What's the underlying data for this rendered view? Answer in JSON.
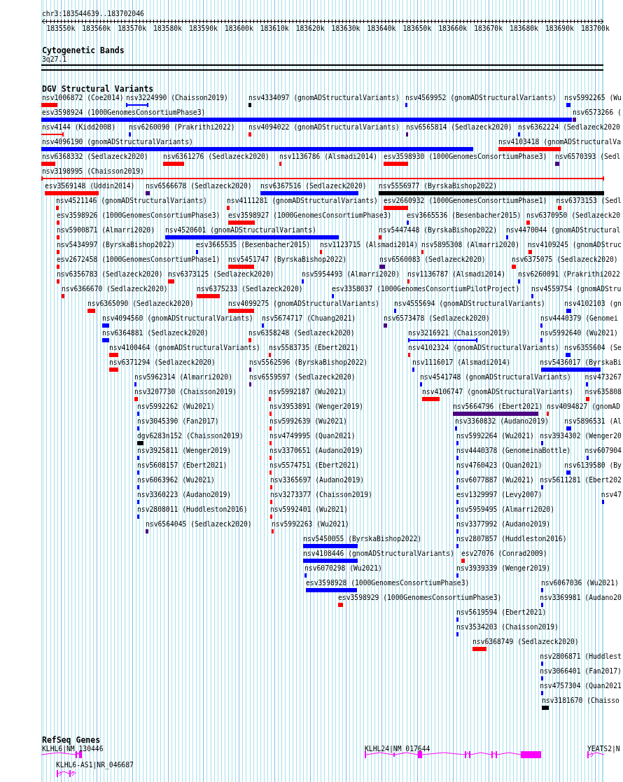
{
  "location": "chr3:183544639..183702046",
  "ruler": {
    "ticks": [
      "183550k",
      "183560k",
      "183570k",
      "183580k",
      "183590k",
      "183600k",
      "183610k",
      "183620k",
      "183630k",
      "183640k",
      "183650k",
      "183660k",
      "183670k",
      "183680k",
      "183690k",
      "183700k"
    ]
  },
  "cytogenetic_bands": {
    "title": "Cytogenetic Bands",
    "band": "3q27.1"
  },
  "dgv_structural_variants": {
    "title": "DGV Structural Variants",
    "features": [
      {
        "label": "nsv1006872 (Coe2014)",
        "color": "#ff0000",
        "kind": "bar"
      },
      {
        "label": "nsv3224990 (Chaisson2019)",
        "color": "#0000ff",
        "kind": "span"
      },
      {
        "label": "nsv4334097 (gnomADStructuralVariants)",
        "color": "#000000",
        "kind": "bar"
      },
      {
        "label": "nsv4569952 (gnomADStructuralVariants)",
        "color": "#0000ff",
        "kind": "bar"
      },
      {
        "label": "nsv5992265 (Wu",
        "color": "#0000ff",
        "kind": "bar"
      },
      {
        "label": "esv3598924 (1000GenomesConsortiumPhase3)",
        "color": "#0000ff",
        "kind": "bar"
      },
      {
        "label": "nsv6573266 (",
        "color": "#4b0082",
        "kind": "bar"
      },
      {
        "label": "nsv4144 (Kidd2008)",
        "color": "#ff0000",
        "kind": "span"
      },
      {
        "label": "nsv6260090 (Prakrithi2022)",
        "color": "#0000ff",
        "kind": "bar"
      },
      {
        "label": "nsv4094022 (gnomADStructuralVariants)",
        "color": "#ff0000",
        "kind": "bar"
      },
      {
        "label": "nsv6565814 (Sedlazeck2020)",
        "color": "#4b0082",
        "kind": "bar"
      },
      {
        "label": "nsv6362224 (Sedlazeck2020",
        "color": "#0000ff",
        "kind": "bar"
      },
      {
        "label": "nsv4096190 (gnomADStructuralVariants)",
        "color": "#0000ff",
        "kind": "bar"
      },
      {
        "label": "nsv4103418 (gnomADStructuralVa",
        "color": "#ff0000",
        "kind": "bar"
      },
      {
        "label": "nsv6368332 (Sedlazeck2020)",
        "color": "#ff0000",
        "kind": "bar"
      },
      {
        "label": "nsv6361276 (Sedlazeck2020)",
        "color": "#ff0000",
        "kind": "bar"
      },
      {
        "label": "nsv1136786 (Alsmadi2014)",
        "color": "#ff0000",
        "kind": "bar"
      },
      {
        "label": "esv3598930 (1000GenomesConsortiumPhase3)",
        "color": "#ff0000",
        "kind": "bar"
      },
      {
        "label": "nsv6570393 (Sedl",
        "color": "#4b0082",
        "kind": "bar"
      },
      {
        "label": "nsv3198995 (Chaisson2019)",
        "color": "#ff0000",
        "kind": "span"
      },
      {
        "label": "esv3569148 (Uddin2014)",
        "color": "#ff0000",
        "kind": "bar"
      },
      {
        "label": "nsv6566678 (Sedlazeck2020)",
        "color": "#4b0082",
        "kind": "bar"
      },
      {
        "label": "nsv6367516 (Sedlazeck2020)",
        "color": "#0000ff",
        "kind": "bar"
      },
      {
        "label": "nsv5556977 (ByrskaBishop2022)",
        "color": "#000000",
        "kind": "bar"
      },
      {
        "label": "nsv4521146 (gnomADStructuralVariants)",
        "color": "#ff0000",
        "kind": "bar"
      },
      {
        "label": "nsv4111281 (gnomADStructuralVariants)",
        "color": "#ff0000",
        "kind": "bar"
      },
      {
        "label": "esv2660932 (1000GenomesConsortiumPhase1)",
        "color": "#ff0000",
        "kind": "bar"
      },
      {
        "label": "nsv6373153 (Sedl",
        "color": "#ff0000",
        "kind": "bar"
      },
      {
        "label": "esv3598926 (1000GenomesConsortiumPhase3)",
        "color": "#ff0000",
        "kind": "bar"
      },
      {
        "label": "esv3598927 (1000GenomesConsortiumPhase3)",
        "color": "#ff0000",
        "kind": "bar"
      },
      {
        "label": "esv3665536 (Besenbacher2015)",
        "color": "#0000ff",
        "kind": "bar"
      },
      {
        "label": "nsv6370950 (Sedlazeck20",
        "color": "#ff0000",
        "kind": "bar"
      },
      {
        "label": "nsv5900871 (Almarri2020)",
        "color": "#ff0000",
        "kind": "bar"
      },
      {
        "label": "nsv4520601 (gnomADStructuralVariants)",
        "color": "#0000ff",
        "kind": "bar"
      },
      {
        "label": "nsv5447448 (ByrskaBishop2022)",
        "color": "#ff0000",
        "kind": "bar"
      },
      {
        "label": "nsv4470044 (gnomADStructural",
        "color": "#0000ff",
        "kind": "bar"
      },
      {
        "label": "nsv5434997 (ByrskaBishop2022)",
        "color": "#ff0000",
        "kind": "bar"
      },
      {
        "label": "esv3665535 (Besenbacher2015)",
        "color": "#0000ff",
        "kind": "bar"
      },
      {
        "label": "nsv1123715 (Alsmadi2014)",
        "color": "#ff0000",
        "kind": "bar"
      },
      {
        "label": "nsv5895308 (Almarri2020)",
        "color": "#ff0000",
        "kind": "bar"
      },
      {
        "label": "nsv4109245 (gnomADStruc",
        "color": "#ff0000",
        "kind": "bar"
      },
      {
        "label": "esv2672458 (1000GenomesConsortiumPhase1)",
        "color": "#ff0000",
        "kind": "bar"
      },
      {
        "label": "nsv5451747 (ByrskaBishop2022)",
        "color": "#ff0000",
        "kind": "bar"
      },
      {
        "label": "nsv6560083 (Sedlazeck2020)",
        "color": "#4b0082",
        "kind": "bar"
      },
      {
        "label": "nsv6375075 (Sedlazeck2020)",
        "color": "#ff0000",
        "kind": "bar"
      },
      {
        "label": "nsv6356783 (Sedlazeck2020)",
        "color": "#ff0000",
        "kind": "bar"
      },
      {
        "label": "nsv6373125 (Sedlazeck2020)",
        "color": "#ff0000",
        "kind": "bar"
      },
      {
        "label": "nsv5954493 (Almarri2020)",
        "color": "#0000ff",
        "kind": "bar"
      },
      {
        "label": "nsv1136787 (Alsmadi2014)",
        "color": "#ff0000",
        "kind": "bar"
      },
      {
        "label": "nsv6260091 (Prakrithi2022",
        "color": "#0000ff",
        "kind": "bar"
      },
      {
        "label": "nsv6366670 (Sedlazeck2020)",
        "color": "#ff0000",
        "kind": "bar"
      },
      {
        "label": "nsv6375233 (Sedlazeck2020)",
        "color": "#ff0000",
        "kind": "bar"
      },
      {
        "label": "esv3358037 (1000GenomesConsortiumPilotProject)",
        "color": "#0000ff",
        "kind": "bar"
      },
      {
        "label": "nsv4559754 (gnomADStru",
        "color": "#0000ff",
        "kind": "bar"
      },
      {
        "label": "nsv6365090 (Sedlazeck2020)",
        "color": "#ff0000",
        "kind": "bar"
      },
      {
        "label": "nsv4099275 (gnomADStructuralVariants)",
        "color": "#ff0000",
        "kind": "bar"
      },
      {
        "label": "nsv4555694 (gnomADStructuralVariants)",
        "color": "#0000ff",
        "kind": "bar"
      },
      {
        "label": "nsv4102103 (gn",
        "color": "#0000ff",
        "kind": "bar"
      },
      {
        "label": "nsv4094560 (gnomADStructuralVariants)",
        "color": "#0000ff",
        "kind": "bar"
      },
      {
        "label": "nsv5674717 (Chuang2021)",
        "color": "#0000ff",
        "kind": "bar"
      },
      {
        "label": "nsv6573478 (Sedlazeck2020)",
        "color": "#4b0082",
        "kind": "bar"
      },
      {
        "label": "nsv4440379 (Genomei",
        "color": "#0000ff",
        "kind": "bar"
      },
      {
        "label": "nsv6364881 (Sedlazeck2020)",
        "color": "#0000ff",
        "kind": "bar"
      },
      {
        "label": "nsv6358248 (Sedlazeck2020)",
        "color": "#ff0000",
        "kind": "bar"
      },
      {
        "label": "nsv3216921 (Chaisson2019)",
        "color": "#0000ff",
        "kind": "span"
      },
      {
        "label": "nsv5992640 (Wu2021)",
        "color": "#0000ff",
        "kind": "bar"
      },
      {
        "label": "nsv4100464 (gnomADStructuralVariants)",
        "color": "#ff0000",
        "kind": "bar"
      },
      {
        "label": "nsv5583735 (Ebert2021)",
        "color": "#ff0000",
        "kind": "bar"
      },
      {
        "label": "nsv4102324 (gnomADStructuralVariants)",
        "color": "#ff0000",
        "kind": "bar"
      },
      {
        "label": "nsv6355604 (Se",
        "color": "#0000ff",
        "kind": "bar"
      },
      {
        "label": "nsv6371294 (Sedlazeck2020)",
        "color": "#ff0000",
        "kind": "bar"
      },
      {
        "label": "nsv5562596 (ByrskaBishop2022)",
        "color": "#4b0082",
        "kind": "bar"
      },
      {
        "label": "nsv1116017 (Alsmadi2014)",
        "color": "#0000ff",
        "kind": "bar"
      },
      {
        "label": "nsv5436017 (ByrskaBi",
        "color": "#0000ff",
        "kind": "bar"
      },
      {
        "label": "nsv5962314 (Almarri2020)",
        "color": "#0000ff",
        "kind": "bar"
      },
      {
        "label": "nsv6559597 (Sedlazeck2020)",
        "color": "#4b0082",
        "kind": "bar"
      },
      {
        "label": "nsv4541748 (gnomADStructuralVariants)",
        "color": "#0000ff",
        "kind": "bar"
      },
      {
        "label": "nsv473267",
        "color": "#0000ff",
        "kind": "bar"
      },
      {
        "label": "nsv3207730 (Chaisson2019)",
        "color": "#ff0000",
        "kind": "bar"
      },
      {
        "label": "nsv5992187 (Wu2021)",
        "color": "#ff0000",
        "kind": "bar"
      },
      {
        "label": "nsv4106747 (gnomADStructuralVariants)",
        "color": "#ff0000",
        "kind": "bar"
      },
      {
        "label": "nsv635808",
        "color": "#ff0000",
        "kind": "bar"
      },
      {
        "label": "nsv5992262 (Wu2021)",
        "color": "#0000ff",
        "kind": "bar"
      },
      {
        "label": "nsv3953891 (Wenger2019)",
        "color": "#ff0000",
        "kind": "bar"
      },
      {
        "label": "nsv5664796 (Ebert2021)",
        "color": "#4b0082",
        "kind": "bar"
      },
      {
        "label": "nsv4094827 (gnomAD",
        "color": "#ff0000",
        "kind": "bar"
      },
      {
        "label": "nsv3045390 (Fan2017)",
        "color": "#0000ff",
        "kind": "bar"
      },
      {
        "label": "nsv5992639 (Wu2021)",
        "color": "#ff0000",
        "kind": "bar"
      },
      {
        "label": "nsv3360832 (Audano2019)",
        "color": "#0000ff",
        "kind": "bar"
      },
      {
        "label": "nsv5896531 (Al",
        "color": "#0000ff",
        "kind": "bar"
      },
      {
        "label": "dgv6283n152 (Chaisson2019)",
        "color": "#000000",
        "kind": "bar"
      },
      {
        "label": "nsv4749995 (Quan2021)",
        "color": "#ff0000",
        "kind": "bar"
      },
      {
        "label": "nsv5992264 (Wu2021)",
        "color": "#0000ff",
        "kind": "bar"
      },
      {
        "label": "nsv3934302 (Wenger20",
        "color": "#0000ff",
        "kind": "bar"
      },
      {
        "label": "nsv3925811 (Wenger2019)",
        "color": "#0000ff",
        "kind": "bar"
      },
      {
        "label": "nsv3370651 (Audano2019)",
        "color": "#ff0000",
        "kind": "bar"
      },
      {
        "label": "nsv4440378 (GenomeinaBottle)",
        "color": "#0000ff",
        "kind": "bar"
      },
      {
        "label": "nsv607904",
        "color": "#0000ff",
        "kind": "bar"
      },
      {
        "label": "nsv5608157 (Ebert2021)",
        "color": "#0000ff",
        "kind": "bar"
      },
      {
        "label": "nsv5574751 (Ebert2021)",
        "color": "#ff0000",
        "kind": "bar"
      },
      {
        "label": "nsv4760423 (Quan2021)",
        "color": "#0000ff",
        "kind": "bar"
      },
      {
        "label": "nsv6139580 (By",
        "color": "#0000ff",
        "kind": "bar"
      },
      {
        "label": "nsv6063962 (Wu2021)",
        "color": "#0000ff",
        "kind": "bar"
      },
      {
        "label": "nsv3365697 (Audano2019)",
        "color": "#ff0000",
        "kind": "bar"
      },
      {
        "label": "nsv6077887 (Wu2021)",
        "color": "#0000ff",
        "kind": "bar"
      },
      {
        "label": "nsv5611281 (Ebert202",
        "color": "#0000ff",
        "kind": "bar"
      },
      {
        "label": "nsv3360223 (Audano2019)",
        "color": "#0000ff",
        "kind": "bar"
      },
      {
        "label": "nsv3273377 (Chaisson2019)",
        "color": "#ff0000",
        "kind": "bar"
      },
      {
        "label": "esv1329997 (Levy2007)",
        "color": "#0000ff",
        "kind": "bar"
      },
      {
        "label": "nsv47",
        "color": "#0000ff",
        "kind": "bar"
      },
      {
        "label": "nsv2808011 (Huddleston2016)",
        "color": "#0000ff",
        "kind": "bar"
      },
      {
        "label": "nsv5992401 (Wu2021)",
        "color": "#ff0000",
        "kind": "bar"
      },
      {
        "label": "nsv5959495 (Almarri2020)",
        "color": "#0000ff",
        "kind": "bar"
      },
      {
        "label": "nsv6564045 (Sedlazeck2020)",
        "color": "#4b0082",
        "kind": "bar"
      },
      {
        "label": "nsv5992263 (Wu2021)",
        "color": "#ff0000",
        "kind": "bar"
      },
      {
        "label": "nsv3377992 (Audano2019)",
        "color": "#0000ff",
        "kind": "bar"
      },
      {
        "label": "nsv5450055 (ByrskaBishop2022)",
        "color": "#0000ff",
        "kind": "bar"
      },
      {
        "label": "nsv2807857 (Huddleston2016)",
        "color": "#0000ff",
        "kind": "bar"
      },
      {
        "label": "nsv4108446 (gnomADStructuralVariants)",
        "color": "#0000ff",
        "kind": "bar"
      },
      {
        "label": "esv27076 (Conrad2009)",
        "color": "#ff0000",
        "kind": "bar"
      },
      {
        "label": "nsv6070298 (Wu2021)",
        "color": "#0000ff",
        "kind": "bar"
      },
      {
        "label": "nsv3939339 (Wenger2019)",
        "color": "#0000ff",
        "kind": "bar"
      },
      {
        "label": "esv3598928 (1000GenomesConsortiumPhase3)",
        "color": "#0000ff",
        "kind": "bar"
      },
      {
        "label": "nsv6067036 (Wu2021)",
        "color": "#0000ff",
        "kind": "bar"
      },
      {
        "label": "esv3598929 (1000GenomesConsortiumPhase3)",
        "color": "#ff0000",
        "kind": "bar"
      },
      {
        "label": "nsv3369981 (Audano20",
        "color": "#0000ff",
        "kind": "bar"
      },
      {
        "label": "nsv5619594 (Ebert2021)",
        "color": "#0000ff",
        "kind": "bar"
      },
      {
        "label": "nsv3534203 (Chaisson2019)",
        "color": "#0000ff",
        "kind": "bar"
      },
      {
        "label": "nsv6368749 (Sedlazeck2020)",
        "color": "#ff0000",
        "kind": "bar"
      },
      {
        "label": "nsv2806871 (Huddlest",
        "color": "#0000ff",
        "kind": "bar"
      },
      {
        "label": "nsv3066401 (Fan2017)",
        "color": "#0000ff",
        "kind": "bar"
      },
      {
        "label": "nsv4757304 (Quan2021",
        "color": "#0000ff",
        "kind": "bar"
      },
      {
        "label": "nsv3181670 (Chaisso",
        "color": "#000000",
        "kind": "bar"
      }
    ]
  },
  "refseq_genes": {
    "title": "RefSeq Genes",
    "genes": [
      {
        "label": "KLHL6|NM_130446"
      },
      {
        "label": "KLHL24|NM_017644"
      },
      {
        "label": "YEATS2|N"
      },
      {
        "label": "KLHL6-AS1|NR_046687"
      }
    ]
  }
}
